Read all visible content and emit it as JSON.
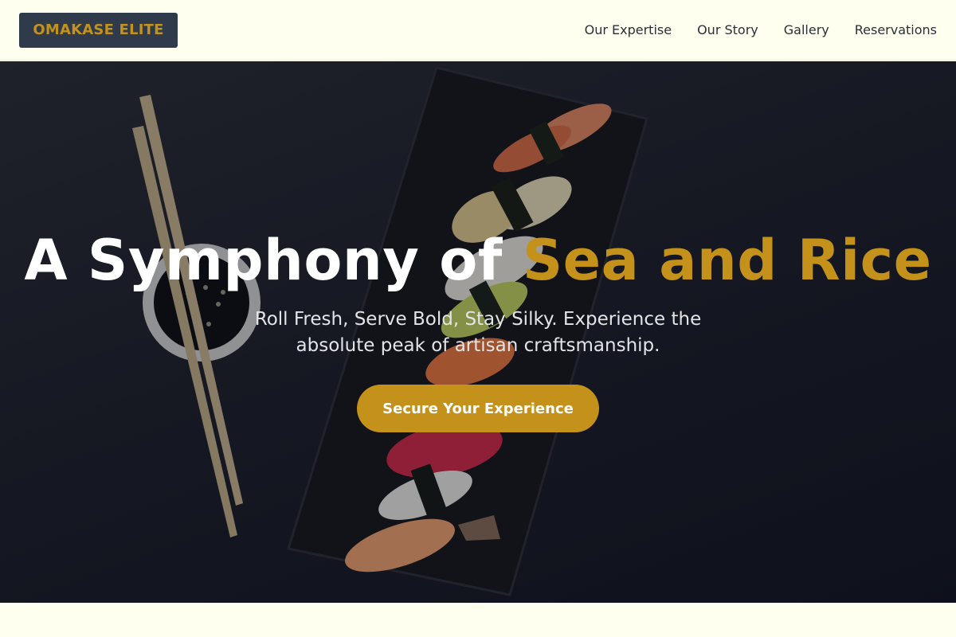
{
  "brand": {
    "name": "OMAKASE ELITE"
  },
  "nav": {
    "links": [
      "Our Expertise",
      "Our Story",
      "Gallery",
      "Reservations"
    ]
  },
  "hero": {
    "title_lead": "A Symphony of",
    "title_accent": "Sea and Rice",
    "subtitle": "Roll Fresh, Serve Bold, Stay Silky. Experience the absolute peak of artisan craftsmanship.",
    "cta_label": "Secure Your Experience",
    "image": {
      "description_icon": "sushi-platter-image"
    }
  },
  "colors": {
    "accent": "#c4911b",
    "logo_bg": "#2f3b4a",
    "page_bg": "#fffff0",
    "nav_text": "#2b2f36"
  }
}
